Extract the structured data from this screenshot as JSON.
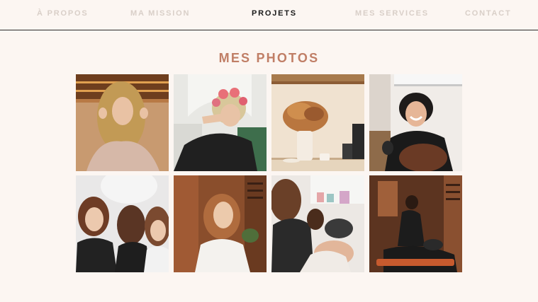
{
  "nav": {
    "items": [
      {
        "label": "À PROPOS",
        "active": false
      },
      {
        "label": "MA MISSION",
        "active": false
      },
      {
        "label": "PROJETS",
        "active": true
      },
      {
        "label": "MES SERVICES",
        "active": false
      },
      {
        "label": "CONTACT",
        "active": false
      }
    ]
  },
  "gallery": {
    "title": "MES PHOTOS",
    "photos": [
      {
        "subject": "woman-hair-portrait"
      },
      {
        "subject": "client-with-rollers"
      },
      {
        "subject": "dried-flowers-shelf"
      },
      {
        "subject": "stylist-laughing"
      },
      {
        "subject": "three-women-group"
      },
      {
        "subject": "curly-hair-portrait"
      },
      {
        "subject": "hair-drying"
      },
      {
        "subject": "hair-washing"
      }
    ]
  },
  "colors": {
    "background": "#fcf6f2",
    "accent": "#c07e66",
    "nav_inactive": "#d9cfc8",
    "nav_active": "#1a1a1a"
  }
}
